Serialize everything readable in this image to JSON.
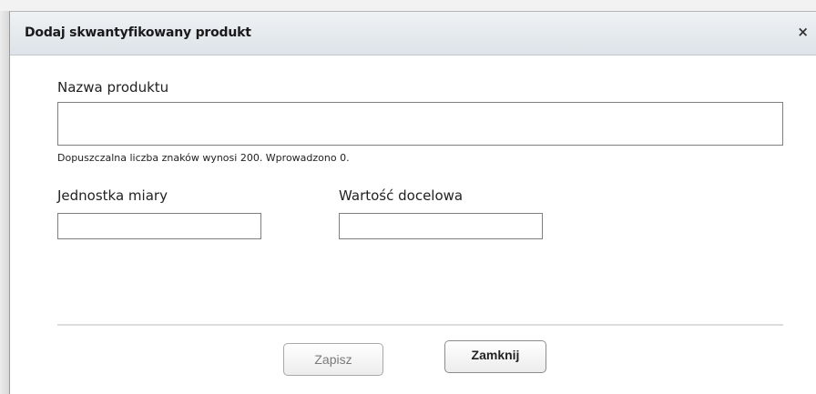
{
  "dialog": {
    "title": "Dodaj skwantyfikowany produkt",
    "close_glyph": "×"
  },
  "form": {
    "product_name_label": "Nazwa produktu",
    "product_name_value": "",
    "char_hint": "Dopuszczalna liczba znaków wynosi 200. Wprowadzono 0.",
    "unit_label": "Jednostka miary",
    "unit_value": "",
    "target_label": "Wartość docelowa",
    "target_value": ""
  },
  "buttons": {
    "save_label": "Zapisz",
    "close_label": "Zamknij"
  },
  "icons": {
    "close": "close-icon"
  }
}
